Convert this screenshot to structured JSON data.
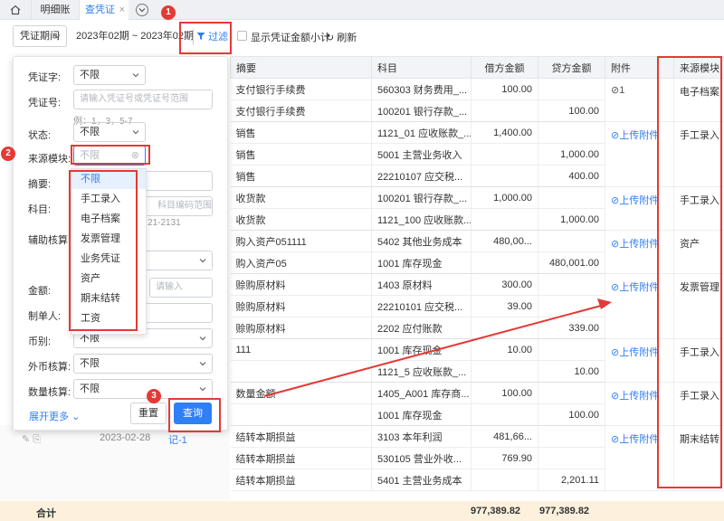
{
  "tabs": {
    "tab1": "明细账",
    "tab2": "查凭证",
    "close": "×"
  },
  "toolbar": {
    "period_select": "凭证期间",
    "date_range": "2023年02期 ~ 2023年02期",
    "filter_label": "过滤",
    "subtotal_label": "显示凭证金额小计",
    "refresh_label": "刷新"
  },
  "filter": {
    "voucher_type_label": "凭证字:",
    "voucher_type_value": "不限",
    "voucher_no_label": "凭证号:",
    "voucher_no_placeholder": "请输入凭证号或凭证号范围",
    "voucher_no_hint": "例：1，3，5-7",
    "status_label": "状态:",
    "status_value": "不限",
    "source_label": "来源模块:",
    "source_value": "不限",
    "summary_label": "摘要:",
    "subject_label": "科目:",
    "subject_placeholder": "科目编码范围",
    "subject_hint": "21-2131",
    "aux_label": "辅助核算:",
    "amount_label": "金额:",
    "amount_placeholder": "请输入",
    "creator_label": "制单人:",
    "currency_label": "币别:",
    "currency_value": "不限",
    "fx_label": "外币核算:",
    "fx_value": "不限",
    "qty_label": "数量核算:",
    "qty_value": "不限",
    "expand_label": "展开更多",
    "reset_label": "重置",
    "query_label": "查询",
    "dropdown": [
      "不限",
      "手工录入",
      "电子档案",
      "发票管理",
      "业务凭证",
      "资产",
      "期末结转",
      "工资"
    ]
  },
  "table": {
    "headers": [
      "摘要",
      "科目",
      "借方金额",
      "贷方金额",
      "附件",
      "来源模块"
    ],
    "rows": [
      [
        "支付银行手续费",
        "560303 财务费用_...",
        "100.00",
        ""
      ],
      [
        "支付银行手续费",
        "100201 银行存款_...",
        "",
        "100.00"
      ],
      [
        "销售",
        "1121_01 应收账款_...",
        "1,400.00",
        ""
      ],
      [
        "销售",
        "5001 主营业务收入",
        "",
        "1,000.00"
      ],
      [
        "销售",
        "22210107 应交税...",
        "",
        "400.00"
      ],
      [
        "收货款",
        "100201 银行存款_...",
        "1,000.00",
        ""
      ],
      [
        "收货款",
        "1121_100 应收账款...",
        "",
        "1,000.00"
      ],
      [
        "购入资产051111",
        "5402 其他业务成本",
        "480,00...",
        ""
      ],
      [
        "购入资产05",
        "1001 库存现金",
        "",
        "480,001.00"
      ],
      [
        "赊购原材料",
        "1403 原材料",
        "300.00",
        ""
      ],
      [
        "赊购原材料",
        "22210101 应交税...",
        "39.00",
        ""
      ],
      [
        "赊购原材料",
        "2202 应付账款",
        "",
        "339.00"
      ],
      [
        "111",
        "1001 库存现金",
        "10.00",
        ""
      ],
      [
        "",
        "1121_5 应收账款_...",
        "",
        "10.00"
      ],
      [
        "数量金额",
        "1405_A001 库存商...",
        "100.00",
        ""
      ],
      [
        "",
        "1001 库存现金",
        "",
        "100.00"
      ],
      [
        "结转本期损益",
        "3103 本年利润",
        "481,66...",
        ""
      ],
      [
        "结转本期损益",
        "530105 营业外收...",
        "769.90",
        ""
      ],
      [
        "结转本期损益",
        "5401 主营业务成本",
        "",
        "2,201.11"
      ]
    ],
    "attachments": {
      "g1": "1",
      "upload": "上传附件"
    },
    "sources": [
      "电子档案",
      "手工录入",
      "手工录入",
      "资产",
      "发票管理",
      "手工录入",
      "手工录入",
      "期末结转"
    ]
  },
  "under_row": {
    "date": "2023-02-28",
    "link": "记-1"
  },
  "footer": {
    "label": "合计",
    "debit": "977,389.82",
    "credit": "977,389.82"
  },
  "badges": [
    "1",
    "2",
    "3"
  ]
}
